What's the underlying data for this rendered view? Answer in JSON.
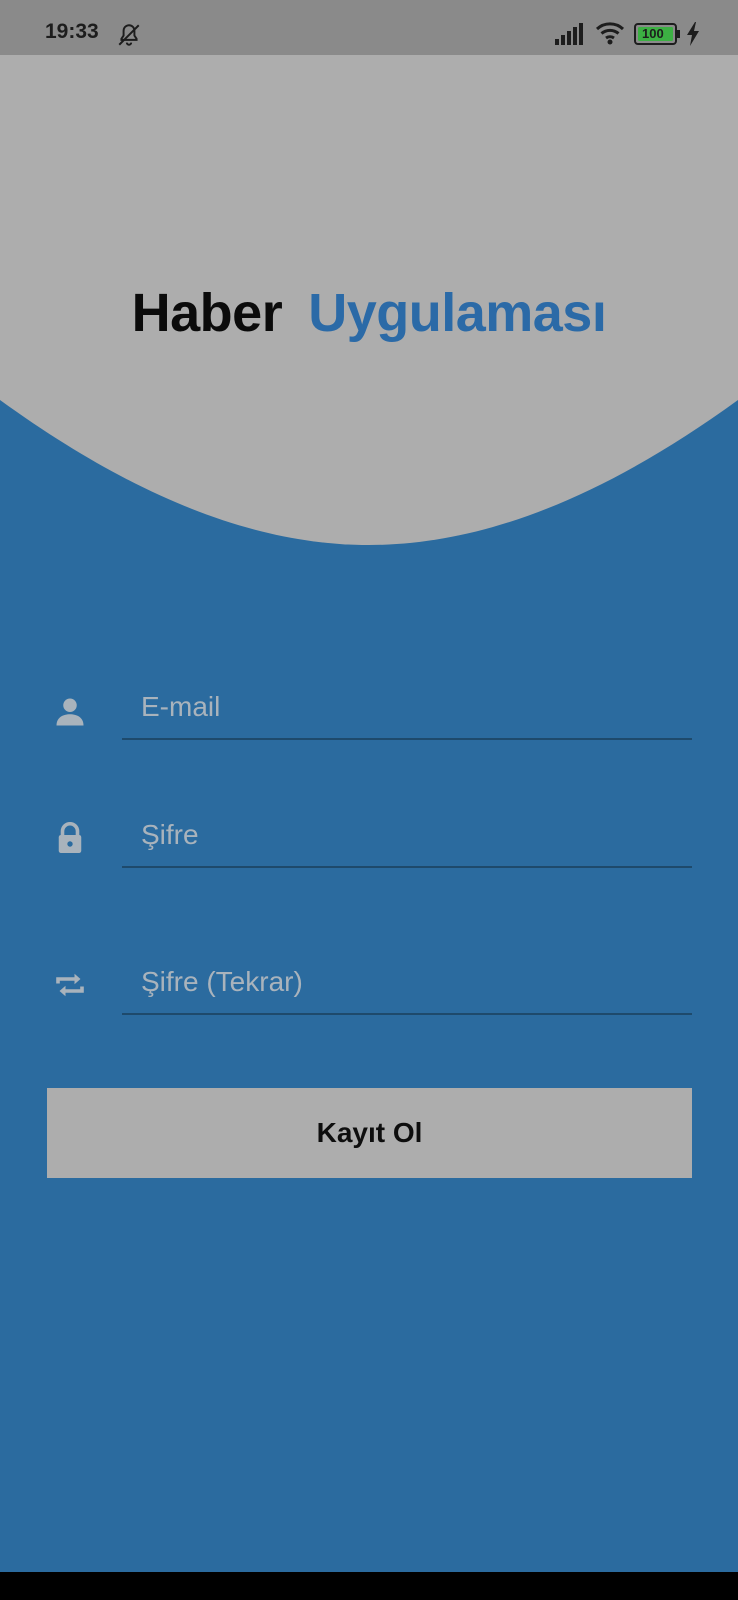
{
  "status_bar": {
    "time": "19:33",
    "battery": "100"
  },
  "header": {
    "title_part1": "Haber",
    "title_part2": "Uygulaması"
  },
  "form": {
    "email_placeholder": "E-mail",
    "password_placeholder": "Şifre",
    "password_repeat_placeholder": "Şifre (Tekrar)",
    "submit_label": "Kayıt Ol"
  },
  "colors": {
    "background": "#2b6b9f",
    "header_gray": "#adadad",
    "accent_blue": "#2b6aa7",
    "icon_gray": "#a9b3bc"
  },
  "icons": {
    "email": "person-icon",
    "password": "lock-icon",
    "password_repeat": "repeat-icon"
  }
}
